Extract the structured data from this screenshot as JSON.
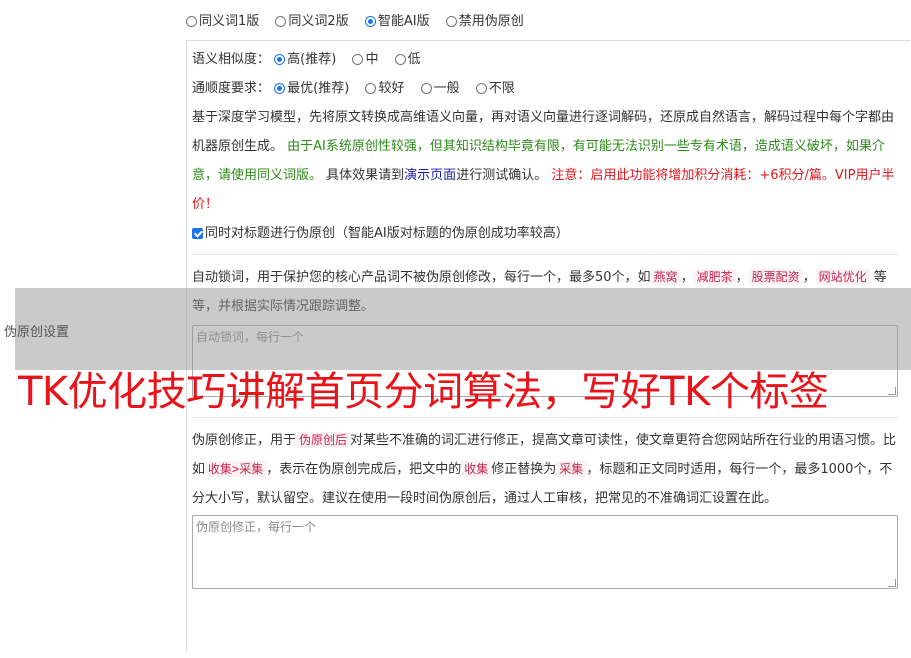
{
  "version_options": [
    {
      "label": "同义词1版",
      "checked": false
    },
    {
      "label": "同义词2版",
      "checked": false
    },
    {
      "label": "智能AI版",
      "checked": true
    },
    {
      "label": "禁用伪原创",
      "checked": false
    }
  ],
  "sidebar_label": "伪原创设置",
  "similarity": {
    "label": "语义相似度：",
    "options": [
      {
        "label": "高(推荐)",
        "checked": true
      },
      {
        "label": "中",
        "checked": false
      },
      {
        "label": "低",
        "checked": false
      }
    ]
  },
  "fluency": {
    "label": "通顺度要求：",
    "options": [
      {
        "label": "最优(推荐)",
        "checked": true
      },
      {
        "label": "较好",
        "checked": false
      },
      {
        "label": "一般",
        "checked": false
      },
      {
        "label": "不限",
        "checked": false
      }
    ]
  },
  "description": {
    "part1": "基于深度学习模型，先将原文转换成高维语义向量，再对语义向量进行逐词解码，还原成自然语言，解码过程中每个字都由机器原创生成。",
    "warning_green": "由于AI系统原创性较强，但其知识结构毕竟有限，有可能无法识别一些专有术语，造成语义破坏，如果介意，请使用同义词版。",
    "part2": "具体效果请到",
    "demo_link": "演示页面",
    "part3": "进行测试确认。",
    "warning_red": "注意：启用此功能将增加积分消耗：+6积分/篇。VIP用户半价！"
  },
  "title_checkbox": {
    "checked": true,
    "label": "同时对标题进行伪原创（智能AI版对标题的伪原创成功率较高）"
  },
  "lock_words": {
    "desc_part1": "自动锁词，用于保护您的核心产品词不被伪原创修改，每行一个，最多50个，如",
    "examples": [
      "燕窝",
      "减肥茶",
      "股票配资",
      "网站优化"
    ],
    "sep": "，",
    "desc_part2": "等等，并根据实际情况跟踪调整。",
    "placeholder": "自动锁词，每行一个"
  },
  "correction": {
    "p1": "伪原创修正，用于",
    "tag1": "伪原创后",
    "p2": "对某些不准确的词汇进行修正，提高文章可读性，使文章更符合您网站所在行业的用语习惯。比如",
    "tag2": "收集>采集",
    "p3": "，表示在伪原创完成后，把文中的",
    "tag3": "收集",
    "p4": "修正替换为",
    "tag4": "采集",
    "p5": "，标题和正文同时适用，每行一个，最多1000个，不分大小写，默认留空。建议在使用一段时间伪原创后，通过人工审核，把常见的不准确词汇设置在此。",
    "placeholder": "伪原创修正，每行一个"
  },
  "overlay_caption": "TK优化技巧讲解首页分词算法，写好TK个标签",
  "colors": {
    "accent": "#1a73e8",
    "green_text": "#2e8b1a",
    "red_text": "#e0181e",
    "link": "#1a1aa6",
    "tag_text": "#c7254e"
  }
}
